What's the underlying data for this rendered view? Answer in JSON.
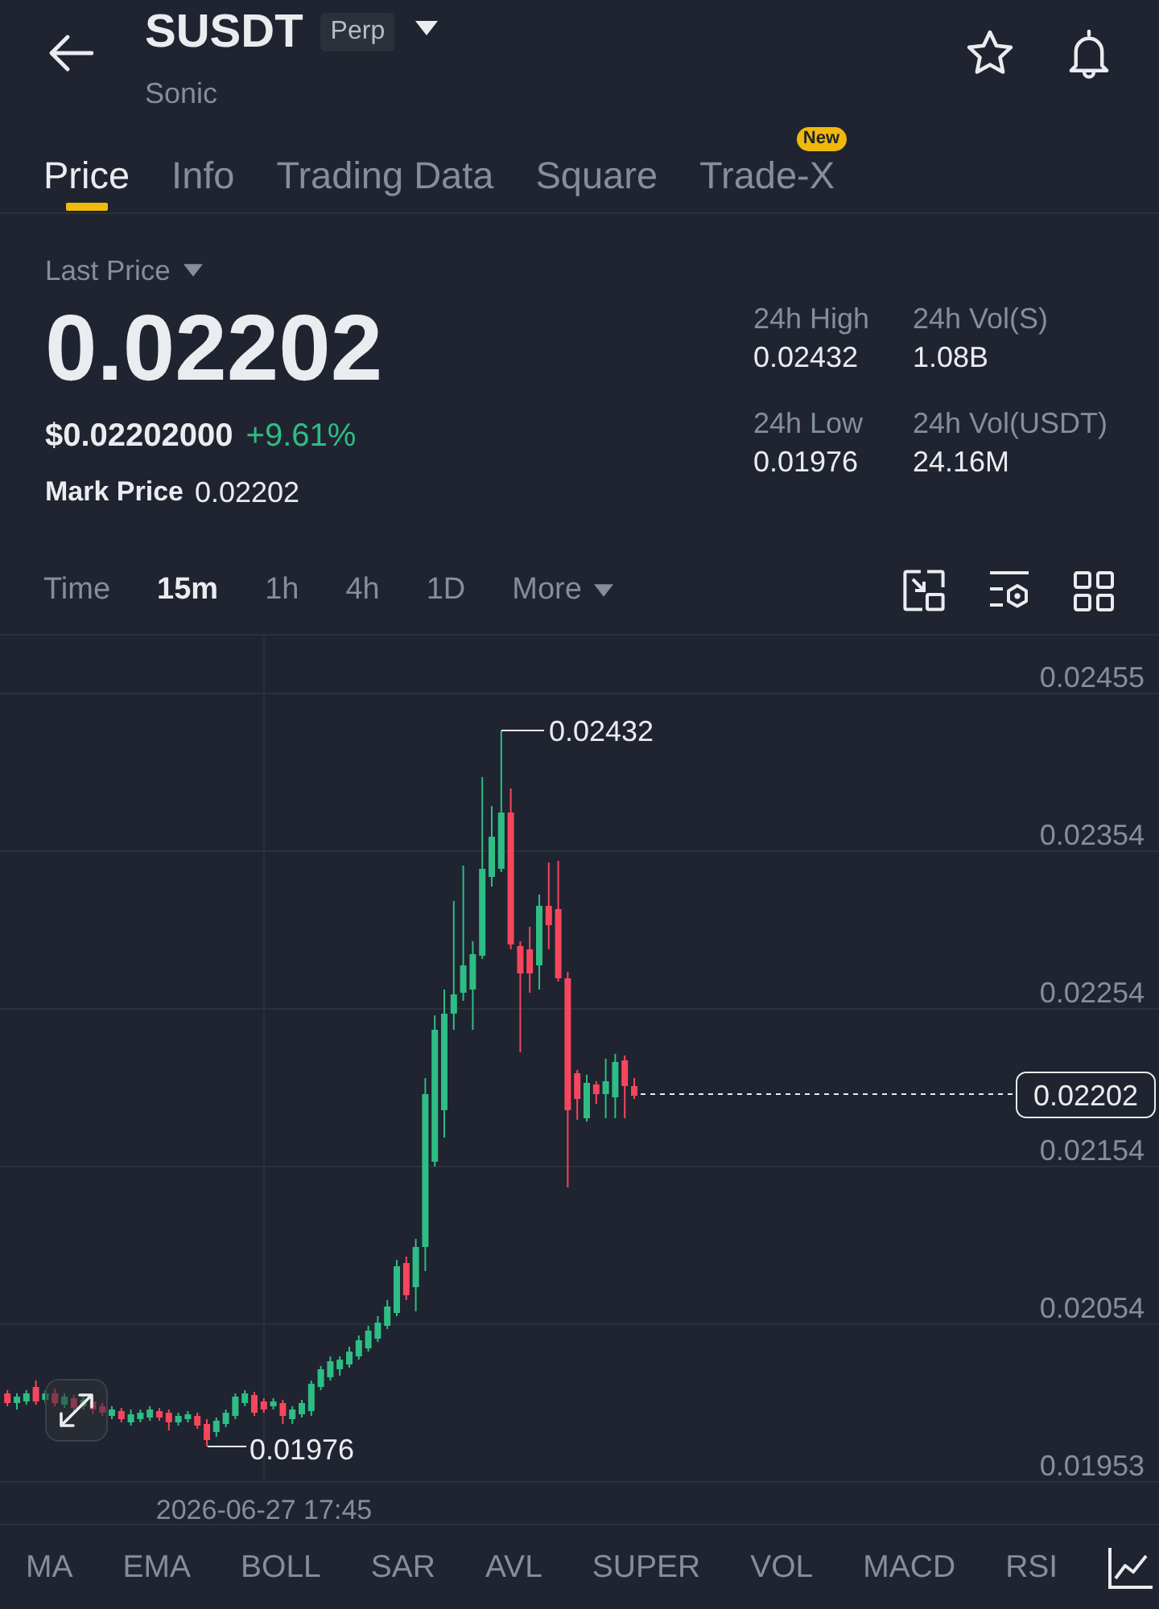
{
  "header": {
    "title": "SUSDT",
    "badge": "Perp",
    "subtitle": "Sonic"
  },
  "tabs": [
    {
      "label": "Price",
      "selected": true
    },
    {
      "label": "Info",
      "selected": false
    },
    {
      "label": "Trading Data",
      "selected": false
    },
    {
      "label": "Square",
      "selected": false
    },
    {
      "label": "Trade-X",
      "selected": false,
      "badge": "New"
    }
  ],
  "price": {
    "label": "Last Price",
    "last": "0.02202",
    "usd": "$0.02202000",
    "change": "+9.61%",
    "mark_label": "Mark Price",
    "mark_value": "0.02202"
  },
  "stats": [
    {
      "label": "24h High",
      "value": "0.02432"
    },
    {
      "label": "24h Vol(S)",
      "value": "1.08B"
    },
    {
      "label": "24h Low",
      "value": "0.01976"
    },
    {
      "label": "24h Vol(USDT)",
      "value": "24.16M"
    }
  ],
  "intervals": [
    {
      "label": "Time",
      "kind": "option",
      "selected": false
    },
    {
      "label": "15m",
      "kind": "option",
      "selected": true
    },
    {
      "label": "1h",
      "kind": "option",
      "selected": false
    },
    {
      "label": "4h",
      "kind": "option",
      "selected": false
    },
    {
      "label": "1D",
      "kind": "option",
      "selected": false
    },
    {
      "label": "More",
      "kind": "menu",
      "selected": false
    }
  ],
  "chart": {
    "y_labels": [
      "0.02455",
      "0.02354",
      "0.02254",
      "0.02154",
      "0.02054",
      "0.01953"
    ],
    "high_label": "0.02432",
    "low_label": "0.01976",
    "price_tag": "0.02202",
    "time_label": "2026-06-27 17:45"
  },
  "indicators": [
    "MA",
    "EMA",
    "BOLL",
    "SAR",
    "AVL",
    "SUPER",
    "VOL",
    "MACD",
    "RSI"
  ]
}
